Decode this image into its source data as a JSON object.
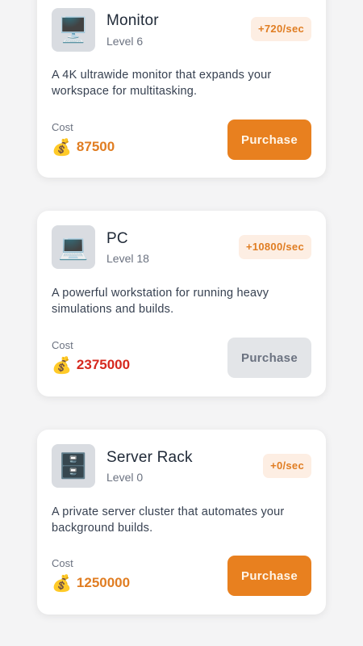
{
  "items": [
    {
      "icon": "monitor-icon",
      "glyph": "🖥️",
      "name": "Monitor",
      "level": "Level 6",
      "rate": "+720/sec",
      "description": "A 4K ultrawide monitor that expands your workspace for multitasking.",
      "cost_label": "Cost",
      "cost_icon": "money-bag-icon",
      "cost_glyph": "💰",
      "cost": "87500",
      "cost_color": "#e07d22",
      "button_label": "Purchase",
      "button_enabled": true
    },
    {
      "icon": "laptop-icon",
      "glyph": "💻",
      "name": "PC",
      "level": "Level 18",
      "rate": "+10800/sec",
      "description": "A powerful workstation for running heavy simulations and builds.",
      "cost_label": "Cost",
      "cost_icon": "money-bag-icon",
      "cost_glyph": "💰",
      "cost": "2375000",
      "cost_color": "#d6281e",
      "button_label": "Purchase",
      "button_enabled": false
    },
    {
      "icon": "file-cabinet-icon",
      "glyph": "🗄️",
      "name": "Server Rack",
      "level": "Level 0",
      "rate": "+0/sec",
      "description": "A private server cluster that automates your background builds.",
      "cost_label": "Cost",
      "cost_icon": "money-bag-icon",
      "cost_glyph": "💰",
      "cost": "1250000",
      "cost_color": "#e07d22",
      "button_label": "Purchase",
      "button_enabled": true
    }
  ],
  "colors": {
    "accent": "#e8801f",
    "unaffordable": "#d6281e",
    "disabled_button": "#e3e5e8"
  }
}
